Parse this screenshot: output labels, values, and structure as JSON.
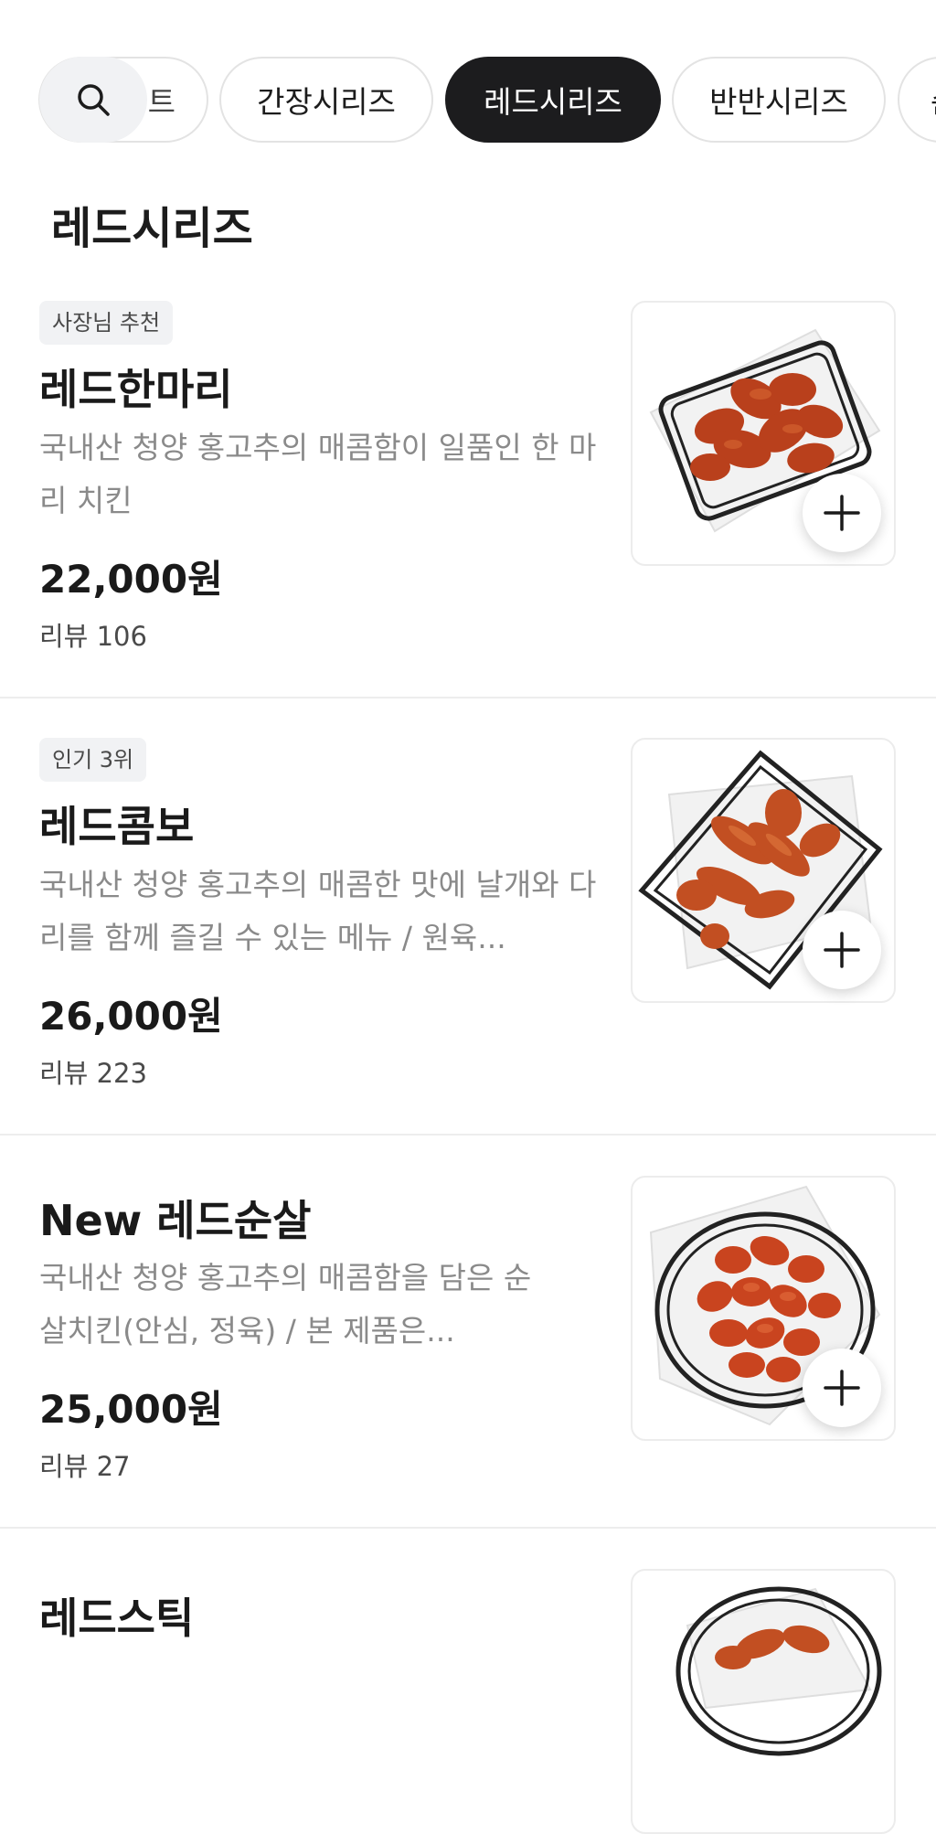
{
  "categories": [
    {
      "label": "트",
      "state": "partial"
    },
    {
      "label": "간장시리즈",
      "state": "default"
    },
    {
      "label": "레드시리즈",
      "state": "active"
    },
    {
      "label": "반반시리즈",
      "state": "default"
    },
    {
      "label": "순",
      "state": "partial"
    }
  ],
  "section_title": "레드시리즈",
  "menu": [
    {
      "badge": "사장님 추천",
      "name": "레드한마리",
      "description": "국내산 청양 홍고추의 매콤함이 일품인 한 마리 치킨",
      "price": "22,000원",
      "review": "리뷰 106"
    },
    {
      "badge": "인기 3위",
      "name": "레드콤보",
      "description": "국내산 청양 홍고추의 매콤한 맛에 날개와 다리를 함께 즐길 수 있는 메뉴 / 원육...",
      "price": "26,000원",
      "review": "리뷰 223"
    },
    {
      "name": "New 레드순살",
      "description": "국내산 청양 홍고추의 매콤함을 담은 순살치킨(안심, 정육) / 본 제품은...",
      "price": "25,000원",
      "review": "리뷰 27"
    },
    {
      "name": "레드스틱"
    }
  ],
  "icons": {
    "search": "search-icon",
    "add": "plus-icon"
  },
  "colors": {
    "active_chip": "#1c1c1e",
    "badge_bg": "#f1f2f4",
    "description": "#8a8a8a",
    "chicken": "#c2421f"
  }
}
